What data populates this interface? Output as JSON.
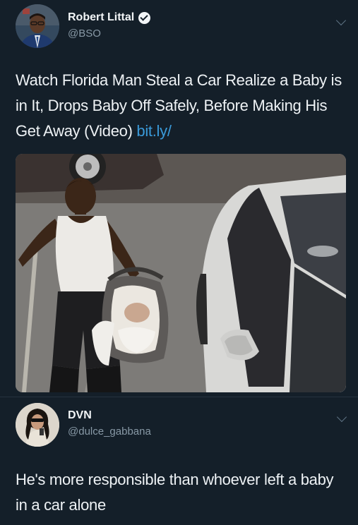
{
  "tweets": [
    {
      "author_name": "Robert Littal",
      "author_handle": "@BSO",
      "verified": true,
      "text_parts": {
        "body": "Watch Florida Man Steal a Car Realize a Baby is in It, Drops Baby Off Safely, Before Making His Get Away (Video) ",
        "link": "bit.ly/"
      },
      "media": {
        "type": "photo"
      }
    },
    {
      "author_name": "DVN",
      "author_handle": "@dulce_gabbana",
      "verified": false,
      "text": "He's more responsible than whoever left a baby in a car alone"
    }
  ],
  "colors": {
    "background": "#141f29",
    "text": "#eef2f5",
    "secondary_text": "#8899a6",
    "link": "#3a9ad9"
  },
  "icons": [
    "verified-badge-icon",
    "chevron-down-icon"
  ]
}
